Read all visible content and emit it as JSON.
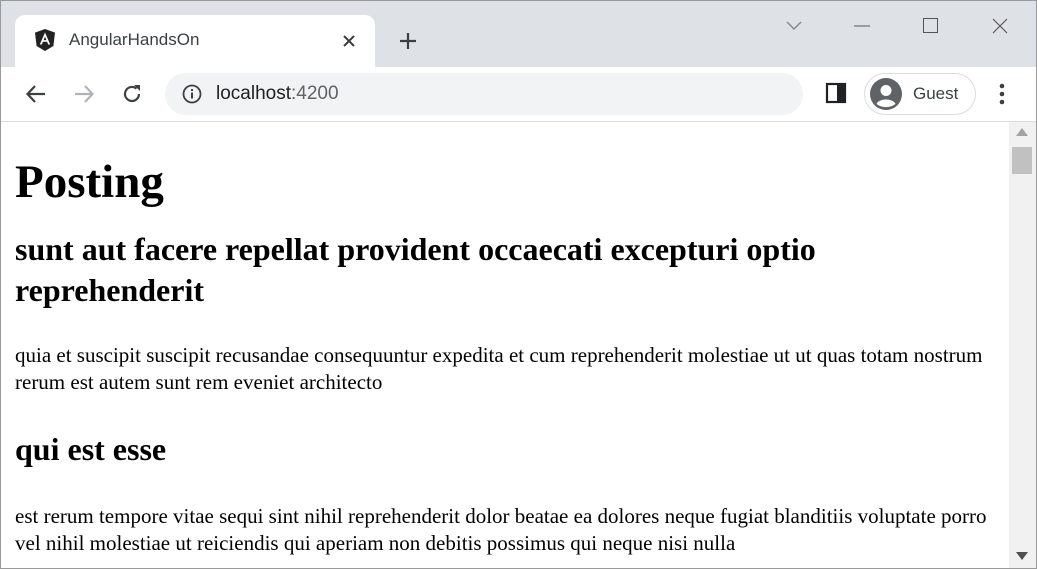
{
  "browser": {
    "tab": {
      "title": "AngularHandsOn",
      "favicon": "angular-logo-icon"
    },
    "url": {
      "host": "localhost",
      "port": ":4200"
    },
    "profile": {
      "label": "Guest"
    },
    "icons": [
      "back-icon",
      "forward-icon",
      "reload-icon",
      "info-icon",
      "side-panel-icon",
      "avatar-icon",
      "more-icon",
      "close-icon",
      "plus-icon",
      "chevron-down-icon",
      "minimize-icon",
      "maximize-icon"
    ]
  },
  "page": {
    "heading": "Posting",
    "posts": [
      {
        "title": "sunt aut facere repellat provident occaecati excepturi optio reprehenderit",
        "body": "quia et suscipit suscipit recusandae consequuntur expedita et cum reprehenderit molestiae ut ut quas totam nostrum rerum est autem sunt rem eveniet architecto"
      },
      {
        "title": "qui est esse",
        "body": "est rerum tempore vitae sequi sint nihil reprehenderit dolor beatae ea dolores neque fugiat blanditiis voluptate porro vel nihil molestiae ut reiciendis qui aperiam non debitis possimus qui neque nisi nulla"
      }
    ]
  }
}
